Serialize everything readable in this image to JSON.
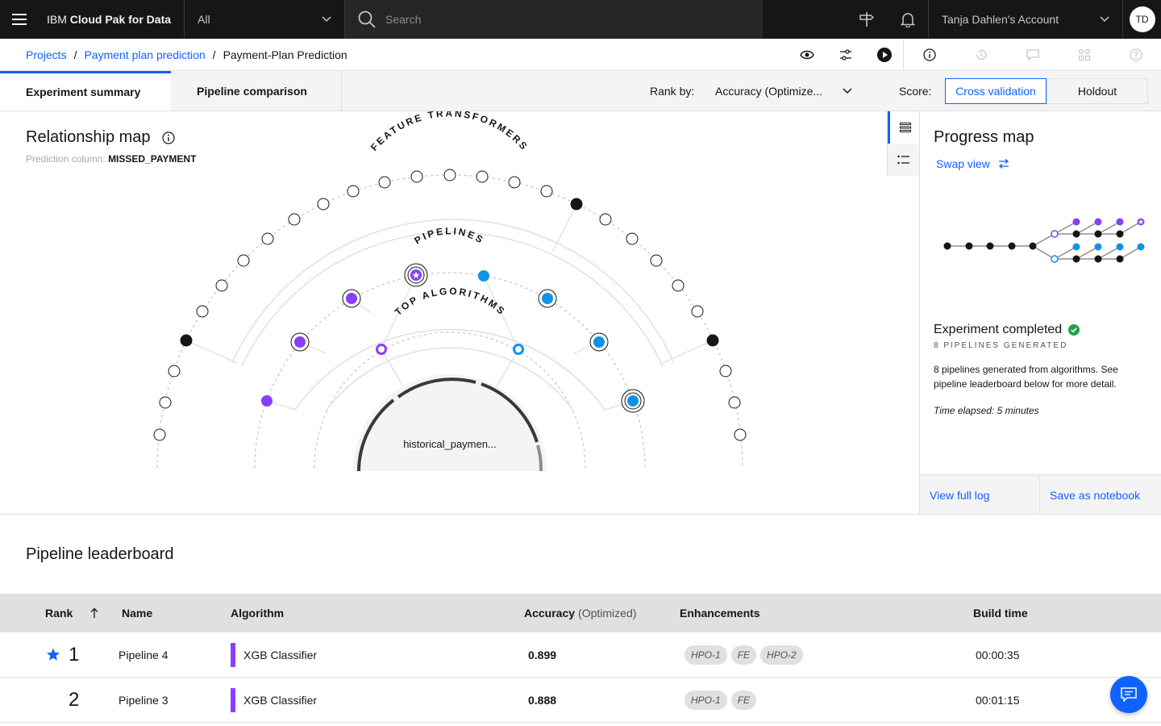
{
  "header": {
    "brand_prefix": "IBM",
    "brand_name": "Cloud Pak for Data",
    "scope_value": "All",
    "search_placeholder": "Search",
    "account_name": "Tanja Dahlen's Account",
    "avatar_initials": "TD"
  },
  "breadcrumb": {
    "items": [
      "Projects",
      "Payment plan prediction"
    ],
    "current": "Payment-Plan Prediction"
  },
  "tabs": [
    {
      "label": "Experiment summary",
      "active": true
    },
    {
      "label": "Pipeline comparison",
      "active": false
    }
  ],
  "rank": {
    "label": "Rank by:",
    "value": "Accuracy (Optimize..."
  },
  "score": {
    "label": "Score:",
    "options": [
      "Cross validation",
      "Holdout"
    ],
    "selected": "Cross validation"
  },
  "relationship_map": {
    "title": "Relationship map",
    "prediction_label": "Prediction column:",
    "prediction_column": "MISSED_PAYMENT",
    "ring_labels": {
      "outer": "FEATURE TRANSFORMERS",
      "middle": "PIPELINES",
      "inner": "TOP ALGORITHMS"
    },
    "dataset": "historical_paymen..."
  },
  "progress_map": {
    "title": "Progress map",
    "swap_label": "Swap view",
    "status": "Experiment completed",
    "generated": "8 PIPELINES GENERATED",
    "description": "8 pipelines generated from algorithms. See pipeline leaderboard below for more detail.",
    "elapsed": "Time elapsed: 5 minutes",
    "footer": [
      "View full log",
      "Save as notebook"
    ]
  },
  "leaderboard": {
    "title": "Pipeline leaderboard",
    "columns": {
      "rank": "Rank",
      "name": "Name",
      "algorithm": "Algorithm",
      "accuracy": "Accuracy",
      "accuracy_note": "(Optimized)",
      "enhancements": "Enhancements",
      "build_time": "Build time"
    },
    "rows": [
      {
        "rank": "1",
        "starred": true,
        "name": "Pipeline 4",
        "algorithm": "XGB Classifier",
        "accuracy": "0.899",
        "enhancements": [
          "HPO-1",
          "FE",
          "HPO-2"
        ],
        "build_time": "00:00:35"
      },
      {
        "rank": "2",
        "starred": false,
        "name": "Pipeline 3",
        "algorithm": "XGB Classifier",
        "accuracy": "0.888",
        "enhancements": [
          "HPO-1",
          "FE"
        ],
        "build_time": "00:01:15"
      }
    ]
  },
  "colors": {
    "accent": "#0f62fe",
    "purple": "#8a3ffc",
    "cyan": "#1192e8",
    "success": "#24a148"
  }
}
